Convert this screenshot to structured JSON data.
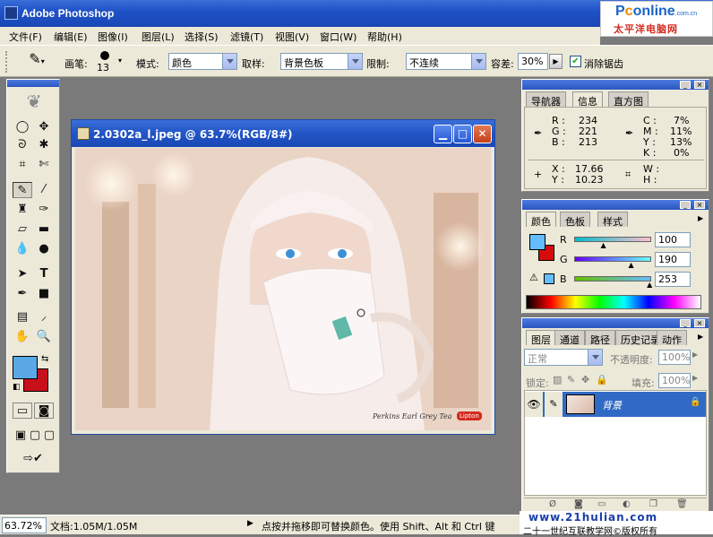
{
  "app": {
    "title": "Adobe Photoshop"
  },
  "logo": {
    "line1_a": "P",
    "line1_b": "c",
    "line1_c": "online",
    "line1_sub": ".com.cn",
    "line2": "太平洋电脑网"
  },
  "menu": [
    "文件(F)",
    "编辑(E)",
    "图像(I)",
    "图层(L)",
    "选择(S)",
    "滤镜(T)",
    "视图(V)",
    "窗口(W)",
    "帮助(H)"
  ],
  "options": {
    "brush_label": "画笔:",
    "brush_size": "13",
    "mode_label": "模式:",
    "mode_value": "颜色",
    "sampling_label": "取样:",
    "sampling_value": "背景色板",
    "limits_label": "限制:",
    "limits_value": "不连续",
    "tolerance_label": "容差:",
    "tolerance_value": "30%",
    "antialias_label": "消除锯齿",
    "antialias_checked": true
  },
  "document": {
    "title": "2.0302a_l.jpeg @ 63.7%(RGB/8#)",
    "caption": "Perkins Earl Grey Tea",
    "brand": "Lipton"
  },
  "info_panel": {
    "tabs": [
      "导航器",
      "信息",
      "直方图"
    ],
    "active_tab": "信息",
    "rgb": [
      {
        "k": "R :",
        "v": "234"
      },
      {
        "k": "G :",
        "v": "221"
      },
      {
        "k": "B :",
        "v": "213"
      }
    ],
    "cmyk": [
      {
        "k": "C :",
        "v": "7%"
      },
      {
        "k": "M :",
        "v": "11%"
      },
      {
        "k": "Y :",
        "v": "13%"
      },
      {
        "k": "K :",
        "v": "0%"
      }
    ],
    "xy": [
      {
        "k": "X :",
        "v": "17.66"
      },
      {
        "k": "Y :",
        "v": "10.23"
      }
    ],
    "wh": [
      {
        "k": "W :",
        "v": ""
      },
      {
        "k": "H :",
        "v": ""
      }
    ]
  },
  "color_panel": {
    "tabs": [
      "颜色",
      "色板",
      "样式"
    ],
    "active_tab": "颜色",
    "channels": [
      {
        "label": "R",
        "value": "100",
        "level": 0.39,
        "gradient": "linear-gradient(90deg,#00becd,#ffbecd)"
      },
      {
        "label": "G",
        "value": "190",
        "level": 0.75,
        "gradient": "linear-gradient(90deg,#6400fd,#64fffd)"
      },
      {
        "label": "B",
        "value": "253",
        "level": 0.99,
        "gradient": "linear-gradient(90deg,#64be00,#64beff)"
      }
    ],
    "foreground": "#64befd",
    "background": "#d40c0c"
  },
  "layers_panel": {
    "tabs": [
      "图层",
      "通道",
      "路径",
      "历史记录",
      "动作"
    ],
    "active_tab": "图层",
    "blend_mode": "正常",
    "opacity_label": "不透明度:",
    "opacity_value": "100%",
    "lock_label": "锁定:",
    "fill_label": "填充:",
    "fill_value": "100%",
    "layers": [
      {
        "name": "背景",
        "visible": true,
        "locked": true
      }
    ]
  },
  "toolbox": {
    "foreground": "#5aa9e6",
    "background": "#c8101a"
  },
  "status": {
    "zoom": "63.72%",
    "doc_info": "文档:1.05M/1.05M",
    "hint": "点按并拖移即可替换颜色。使用 Shift、Alt 和 Ctrl 键",
    "watermark_url": "www.21hulian.com",
    "watermark_text": "二十一世纪互联教学网©版权所有"
  }
}
